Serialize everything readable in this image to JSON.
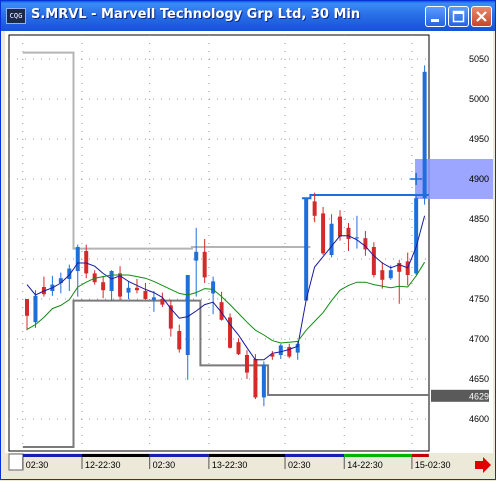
{
  "window": {
    "title": "S.MRVL - Marvell Technology Grp Ltd, 30 Min",
    "icon_label": "CQG",
    "minimize_icon": "minimize-icon",
    "maximize_icon": "maximize-icon",
    "close_icon": "close-icon",
    "scroll_arrow_icon": "arrow-right-icon"
  },
  "colors": {
    "up_candle": "#1e6fd9",
    "down_candle": "#d42a2a",
    "fast_ma": "#1a1aa0",
    "slow_ma": "#138a13",
    "upper_stop": "#b4b4b4",
    "lower_stop": "#7a7a7a",
    "cursor_line": "#1e6fd9",
    "price_highlight": "#8c96ff",
    "session_bar_blue": "#1420b4",
    "session_bar_green": "#00b400"
  },
  "chart_data": {
    "type": "candlestick",
    "symbol": "S.MRVL",
    "ylim": [
      4560,
      5080
    ],
    "y_ticks": [
      "5050",
      "5000",
      "4950",
      "4900",
      "4850",
      "4800",
      "4750",
      "4700",
      "4650",
      "4600"
    ],
    "x_ticks": [
      "02:30",
      "12-22:30",
      "02:30",
      "13-22:30",
      "02:30",
      "14-22:30",
      "15-02:30"
    ],
    "x_tick_pos": [
      0,
      7,
      15,
      22,
      31,
      38,
      46
    ],
    "current_price": "4629",
    "current_price_value": 4629,
    "cursor_price": "4900",
    "cursor_price_value": 4900,
    "candles": [
      [
        4729,
        4746,
        4711,
        4750,
        "d"
      ],
      [
        4754,
        4761,
        4714,
        4721,
        "u"
      ],
      [
        4765,
        4778,
        4753,
        4756,
        "d"
      ],
      [
        4768,
        4779,
        4754,
        4760,
        "u"
      ],
      [
        4770,
        4783,
        4757,
        4776,
        "u"
      ],
      [
        4788,
        4793,
        4760,
        4775,
        "u"
      ],
      [
        4785,
        4818,
        4753,
        4815,
        "u"
      ],
      [
        4810,
        4818,
        4776,
        4782,
        "d"
      ],
      [
        4782,
        4786,
        4768,
        4771,
        "d"
      ],
      [
        4771,
        4779,
        4751,
        4761,
        "d"
      ],
      [
        4760,
        4786,
        4748,
        4785,
        "u"
      ],
      [
        4782,
        4791,
        4749,
        4753,
        "d"
      ],
      [
        4758,
        4772,
        4750,
        4764,
        "u"
      ],
      [
        4764,
        4775,
        4757,
        4761,
        "d"
      ],
      [
        4760,
        4770,
        4749,
        4750,
        "d"
      ],
      [
        4749,
        4760,
        4734,
        4752,
        "u"
      ],
      [
        4750,
        4758,
        4740,
        4743,
        "d"
      ],
      [
        4742,
        4749,
        4703,
        4713,
        "d"
      ],
      [
        4710,
        4718,
        4683,
        4687,
        "d"
      ],
      [
        4680,
        4780,
        4649,
        4780,
        "u"
      ],
      [
        4798,
        4839,
        4753,
        4809,
        "u"
      ],
      [
        4809,
        4825,
        4770,
        4777,
        "d"
      ],
      [
        4772,
        4778,
        4731,
        4757,
        "u"
      ],
      [
        4746,
        4759,
        4723,
        4724,
        "d"
      ],
      [
        4727,
        4732,
        4688,
        4689,
        "d"
      ],
      [
        4696,
        4701,
        4680,
        4681,
        "d"
      ],
      [
        4680,
        4686,
        4650,
        4658,
        "d"
      ],
      [
        4675,
        4681,
        4625,
        4627,
        "d"
      ],
      [
        4627,
        4672,
        4616,
        4668,
        "u"
      ],
      [
        4678,
        4685,
        4674,
        4681,
        "d"
      ],
      [
        4680,
        4694,
        4675,
        4692,
        "u"
      ],
      [
        4690,
        4694,
        4676,
        4678,
        "d"
      ],
      [
        4683,
        4697,
        4674,
        4694,
        "u"
      ],
      [
        4748,
        4876,
        4748,
        4876,
        "u"
      ],
      [
        4872,
        4883,
        4846,
        4854,
        "d"
      ],
      [
        4857,
        4865,
        4805,
        4807,
        "d"
      ],
      [
        4805,
        4856,
        4802,
        4844,
        "u"
      ],
      [
        4853,
        4861,
        4823,
        4828,
        "d"
      ],
      [
        4839,
        4845,
        4810,
        4825,
        "d"
      ],
      [
        4827,
        4854,
        4813,
        4826,
        "u"
      ],
      [
        4826,
        4835,
        4804,
        4812,
        "d"
      ],
      [
        4815,
        4821,
        4777,
        4780,
        "d"
      ],
      [
        4786,
        4796,
        4763,
        4774,
        "d"
      ],
      [
        4776,
        4792,
        4774,
        4786,
        "u"
      ],
      [
        4795,
        4799,
        4744,
        4784,
        "d"
      ],
      [
        4797,
        4808,
        4767,
        4780,
        "d"
      ],
      [
        4782,
        4880,
        4780,
        4876,
        "u"
      ],
      [
        4876,
        5042,
        4868,
        5034,
        "u"
      ]
    ],
    "series": [
      {
        "kind": "fast_ma",
        "values": [
          4768,
          4755,
          4760,
          4764,
          4770,
          4780,
          4795,
          4795,
          4791,
          4782,
          4775,
          4779,
          4772,
          4767,
          4762,
          4758,
          4752,
          4738,
          4726,
          4728,
          4735,
          4743,
          4746,
          4733,
          4718,
          4705,
          4689,
          4674,
          4674,
          4682,
          4684,
          4687,
          4691,
          4749,
          4790,
          4803,
          4816,
          4829,
          4829,
          4824,
          4816,
          4804,
          4795,
          4789,
          4793,
          4789,
          4815,
          4854
        ]
      },
      {
        "kind": "slow_ma",
        "values": [
          4712,
          4718,
          4727,
          4738,
          4742,
          4749,
          4765,
          4771,
          4776,
          4778,
          4780,
          4780,
          4780,
          4778,
          4776,
          4772,
          4767,
          4762,
          4757,
          4755,
          4758,
          4763,
          4762,
          4753,
          4743,
          4732,
          4721,
          4711,
          4705,
          4698,
          4695,
          4696,
          4697,
          4711,
          4722,
          4733,
          4748,
          4761,
          4767,
          4771,
          4771,
          4768,
          4766,
          4764,
          4766,
          4765,
          4779,
          4796
        ]
      },
      {
        "kind": "upper_stop",
        "values": [
          5058,
          5058,
          5058,
          5058,
          5058,
          5058,
          4813,
          4813,
          4813,
          4813,
          4813,
          4813,
          4813,
          4813,
          4813,
          4813,
          4813,
          4813,
          4813,
          4813,
          4815,
          4815,
          4815,
          4815,
          4815,
          4815,
          4815,
          4815,
          4815,
          4815,
          4815,
          4815,
          4815,
          4815,
          null,
          null,
          null,
          null,
          null,
          null,
          null,
          null,
          null,
          null,
          null,
          null,
          null,
          null
        ]
      },
      {
        "kind": "lower_stop",
        "values": [
          4565,
          4565,
          4565,
          4565,
          4565,
          4565,
          4748,
          4748,
          4748,
          4748,
          4748,
          4748,
          4748,
          4748,
          4748,
          4748,
          4748,
          4748,
          4748,
          4748,
          4748,
          4667,
          4667,
          4667,
          4667,
          4667,
          4667,
          4667,
          4667,
          4630,
          4630,
          4630,
          4630,
          4630,
          4630,
          4630,
          4630,
          4630,
          4630,
          4630,
          4630,
          4630,
          4630,
          4630,
          4630,
          4630,
          4630,
          4630
        ]
      },
      {
        "kind": "cursor_line",
        "values": [
          null,
          null,
          null,
          null,
          null,
          null,
          null,
          null,
          null,
          null,
          null,
          null,
          null,
          null,
          null,
          null,
          null,
          null,
          null,
          null,
          null,
          null,
          null,
          null,
          null,
          null,
          null,
          null,
          null,
          null,
          null,
          null,
          null,
          4876,
          4880,
          4880,
          4880,
          4880,
          4880,
          4880,
          4880,
          4880,
          4880,
          4880,
          4880,
          4880,
          4880,
          4880
        ]
      }
    ]
  }
}
